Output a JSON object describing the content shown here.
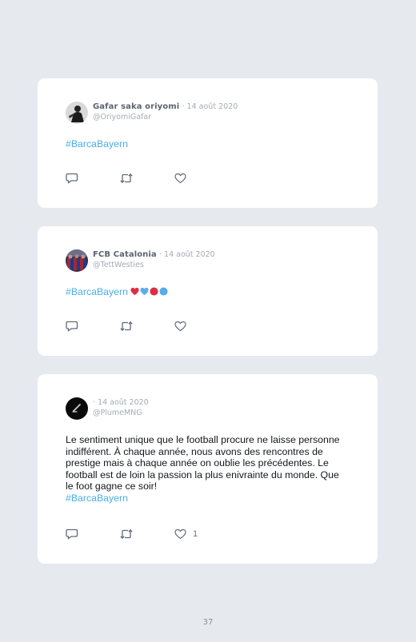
{
  "tweets": [
    {
      "display_name": "Gafar saka oriyomi",
      "date": "· 14 août 2020",
      "handle": "@OriyomiGafar",
      "text": "",
      "hashtag": "#BarcaBayern",
      "emojis": [],
      "like_count": ""
    },
    {
      "display_name": "FCB Catalonia",
      "date": "· 14 août 2020",
      "handle": "@TettWesties",
      "text": "",
      "hashtag": "#BarcaBayern",
      "emojis": [
        "red-heart-emoji",
        "blue-heart-emoji",
        "red-circle-emoji",
        "blue-circle-emoji"
      ],
      "like_count": ""
    },
    {
      "display_name": "",
      "date": "· 14 août 2020",
      "handle": "@PlumeMNG",
      "text": "Le sentiment unique que le football procure ne laisse personne indifférent. À chaque année, nous avons des rencontres de prestige mais à chaque année on oublie les précédentes. Le football est de loin la passion la plus enivrainte du monde. Que le foot gagne ce soir!",
      "hashtag": "#BarcaBayern",
      "emojis": [],
      "like_count": "1"
    }
  ],
  "icons": {
    "reply": "speech-bubble-icon",
    "retweet": "retweet-icon",
    "like": "heart-icon"
  },
  "colors": {
    "background": "#e6e9ee",
    "card": "#ffffff",
    "hashtag": "#4aaee8",
    "muted": "#a3acb5",
    "name": "#5b6470"
  },
  "page_number": "37"
}
